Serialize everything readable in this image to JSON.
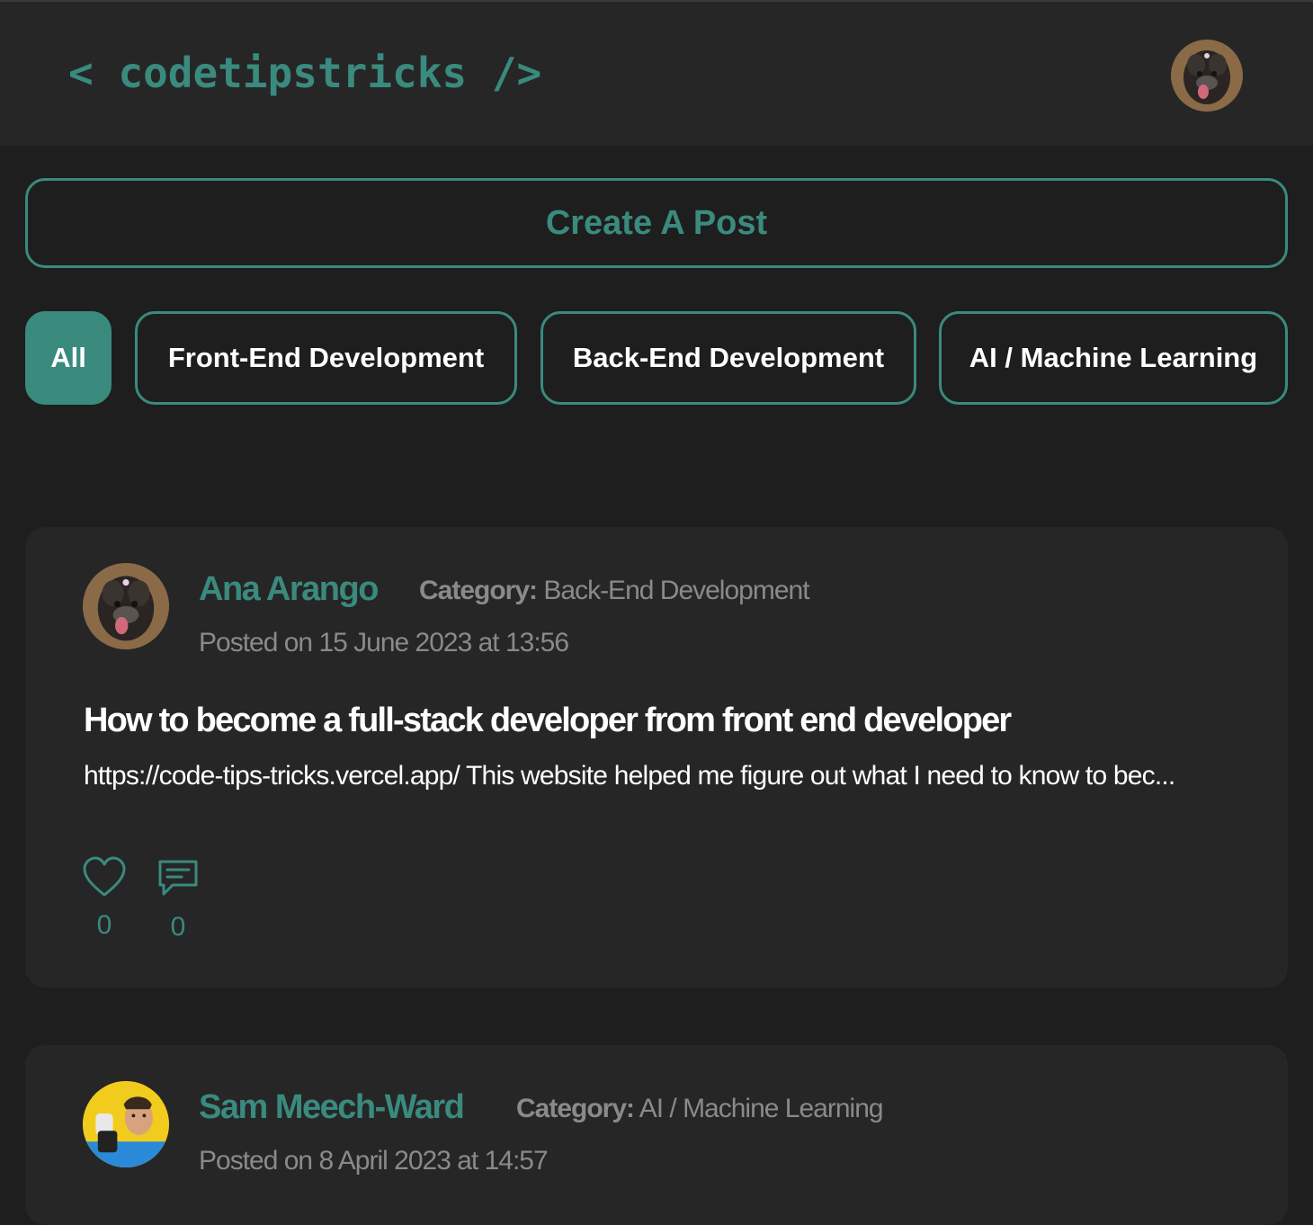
{
  "header": {
    "logo_text": "< codetipstricks />",
    "avatar_icon": "user-avatar-dog"
  },
  "create_post": {
    "label": "Create A Post"
  },
  "filters": [
    {
      "label": "All",
      "active": true
    },
    {
      "label": "Front-End Development",
      "active": false
    },
    {
      "label": "Back-End Development",
      "active": false
    },
    {
      "label": "AI / Machine Learning",
      "active": false
    }
  ],
  "posts": [
    {
      "author": "Ana Arango",
      "category_label": "Category:",
      "category": "Back-End Development",
      "posted": "Posted on 15 June 2023 at 13:56",
      "title": "How to become a full-stack developer from front end developer",
      "excerpt": "https://code-tips-tricks.vercel.app/ This website helped me figure out what I need to know to bec...",
      "likes": "0",
      "comments": "0",
      "avatar_icon": "dog-avatar"
    },
    {
      "author": "Sam Meech-Ward",
      "category_label": "Category:",
      "category": "AI / Machine Learning",
      "posted": "Posted on 8 April 2023 at 14:57",
      "avatar_icon": "person-avatar"
    }
  ],
  "colors": {
    "accent": "#3a8a7e",
    "background": "#1e1e1e",
    "card": "#262626",
    "muted": "#8a8a8a"
  }
}
